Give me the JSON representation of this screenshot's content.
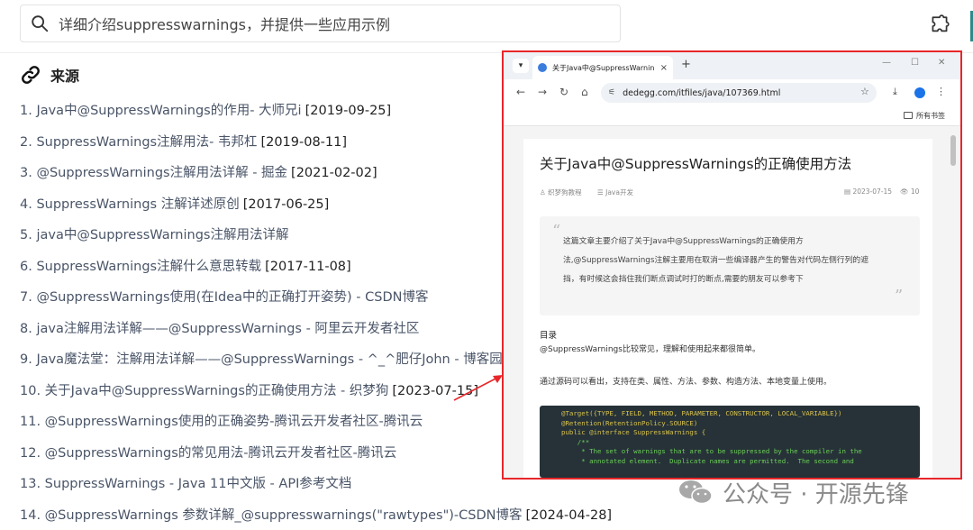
{
  "search": {
    "query": "详细介绍suppresswarnings，并提供一些应用示例"
  },
  "sources": {
    "heading": "来源",
    "items": [
      {
        "title": "1. Java中@SuppressWarnings的作用- 大师兄i",
        "date": "[2019-09-25]"
      },
      {
        "title": "2. SuppressWarnings注解用法- 韦邦杠",
        "date": "[2019-08-11]"
      },
      {
        "title": "3. @SuppressWarnings注解用法详解 - 掘金",
        "date": "[2021-02-02]"
      },
      {
        "title": "4. SuppressWarnings 注解详述原创",
        "date": "[2017-06-25]"
      },
      {
        "title": "5. java中@SuppressWarnings注解用法详解",
        "date": ""
      },
      {
        "title": "6. SuppressWarnings注解什么意思转载",
        "date": "[2017-11-08]"
      },
      {
        "title": "7. @SuppressWarnings使用(在Idea中的正确打开姿势) - CSDN博客",
        "date": ""
      },
      {
        "title": "8. java注解用法详解——@SuppressWarnings - 阿里云开发者社区",
        "date": ""
      },
      {
        "title": "9. Java魔法堂：注解用法详解——@SuppressWarnings - ^_^肥仔John - 博客园",
        "date": ""
      },
      {
        "title": "10. 关于Java中@SuppressWarnings的正确使用方法 - 织梦狗",
        "date": "[2023-07-15]"
      },
      {
        "title": "11. @SuppressWarnings使用的正确姿势-腾讯云开发者社区-腾讯云",
        "date": ""
      },
      {
        "title": "12. @SuppressWarnings的常见用法-腾讯云开发者社区-腾讯云",
        "date": ""
      },
      {
        "title": "13. SuppressWarnings - Java 11中文版 - API参考文档",
        "date": ""
      },
      {
        "title": "14. @SuppressWarnings 参数详解_@suppresswarnings(\"rawtypes\")-CSDN博客",
        "date": "[2024-04-28]"
      }
    ]
  },
  "browser": {
    "tab_title": "关于Java中@SuppressWarnin",
    "tab_close": "×",
    "new_tab": "+",
    "url": "dedegg.com/itfiles/java/107369.html",
    "bookmarks_label": "所有书签",
    "article": {
      "title": "关于Java中@SuppressWarnings的正确使用方法",
      "author": "织梦狗教程",
      "category": "Java开发",
      "date": "2023-07-15",
      "views": "10",
      "summary": "这篇文章主要介绍了关于Java中@SuppressWarnings的正确使用方法,@SuppressWarnings注解主要用在取消一些编译器产生的警告对代码左侧行列的遮挡，有时候这会挡住我们断点调试时打的断点,需要的朋友可以参考下",
      "toc_heading": "目录",
      "para1": "@SuppressWarnings比较常见，理解和使用起来都很简单。",
      "para2": "通过源码可以看出，支持在类、属性、方法、参数、构造方法、本地变量上使用。",
      "code": [
        "@Target({TYPE, FIELD, METHOD, PARAMETER, CONSTRUCTOR, LOCAL_VARIABLE})",
        "@Retention(RetentionPolicy.SOURCE)",
        "public @interface SuppressWarnings {",
        "    /**",
        "     * The set of warnings that are to be suppressed by the compiler in the",
        "     * annotated element.  Duplicate names are permitted.  The second and"
      ]
    }
  },
  "watermark": {
    "text": "公众号 · 开源先锋"
  },
  "colors": {
    "highlight_border": "#e8262a",
    "link_text": "#4a5568",
    "code_bg": "#263238"
  }
}
